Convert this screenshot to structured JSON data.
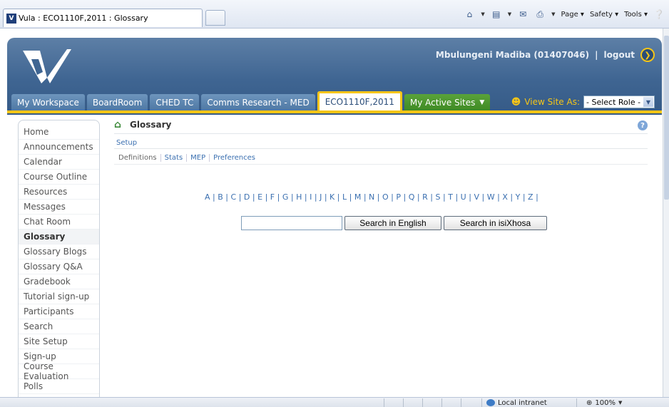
{
  "browser": {
    "tab_title": "Vula : ECO1110F,2011 : Glossary",
    "toolbar": {
      "page_label": "Page",
      "safety_label": "Safety",
      "tools_label": "Tools"
    },
    "status": {
      "zone": "Local intranet",
      "zoom": "100%"
    }
  },
  "header": {
    "user_name": "Mbulungeni Madiba (01407046)",
    "separator": "|",
    "logout_label": "logout",
    "site_tabs": [
      {
        "label": "My Workspace"
      },
      {
        "label": "BoardRoom"
      },
      {
        "label": "CHED TC"
      },
      {
        "label": "Comms Research - MED"
      },
      {
        "label": "ECO1110F,2011"
      },
      {
        "label": "My Active Sites"
      }
    ],
    "view_site_as_label": "View Site As:",
    "role_select_value": "- Select Role -"
  },
  "nav": {
    "items": [
      {
        "label": "Home"
      },
      {
        "label": "Announcements"
      },
      {
        "label": "Calendar"
      },
      {
        "label": "Course Outline"
      },
      {
        "label": "Resources"
      },
      {
        "label": "Messages"
      },
      {
        "label": "Chat Room"
      },
      {
        "label": "Glossary"
      },
      {
        "label": "Glossary Blogs"
      },
      {
        "label": "Glossary Q&A"
      },
      {
        "label": "Gradebook"
      },
      {
        "label": "Tutorial sign-up"
      },
      {
        "label": "Participants"
      },
      {
        "label": "Search"
      },
      {
        "label": "Site Setup"
      },
      {
        "label": "Sign-up"
      },
      {
        "label": "Course Evaluation"
      },
      {
        "label": "Polls"
      }
    ]
  },
  "main": {
    "tool_title": "Glossary",
    "setup_label": "Setup",
    "subnav": [
      "Definitions",
      "Stats",
      "MEP",
      "Preferences"
    ],
    "alphabet": [
      "A",
      "B",
      "C",
      "D",
      "E",
      "F",
      "G",
      "H",
      "I",
      "J",
      "K",
      "L",
      "M",
      "N",
      "O",
      "P",
      "Q",
      "R",
      "S",
      "T",
      "U",
      "V",
      "W",
      "X",
      "Y",
      "Z"
    ],
    "search_value": "",
    "search_english_label": "Search in English",
    "search_xhosa_label": "Search in isiXhosa"
  }
}
